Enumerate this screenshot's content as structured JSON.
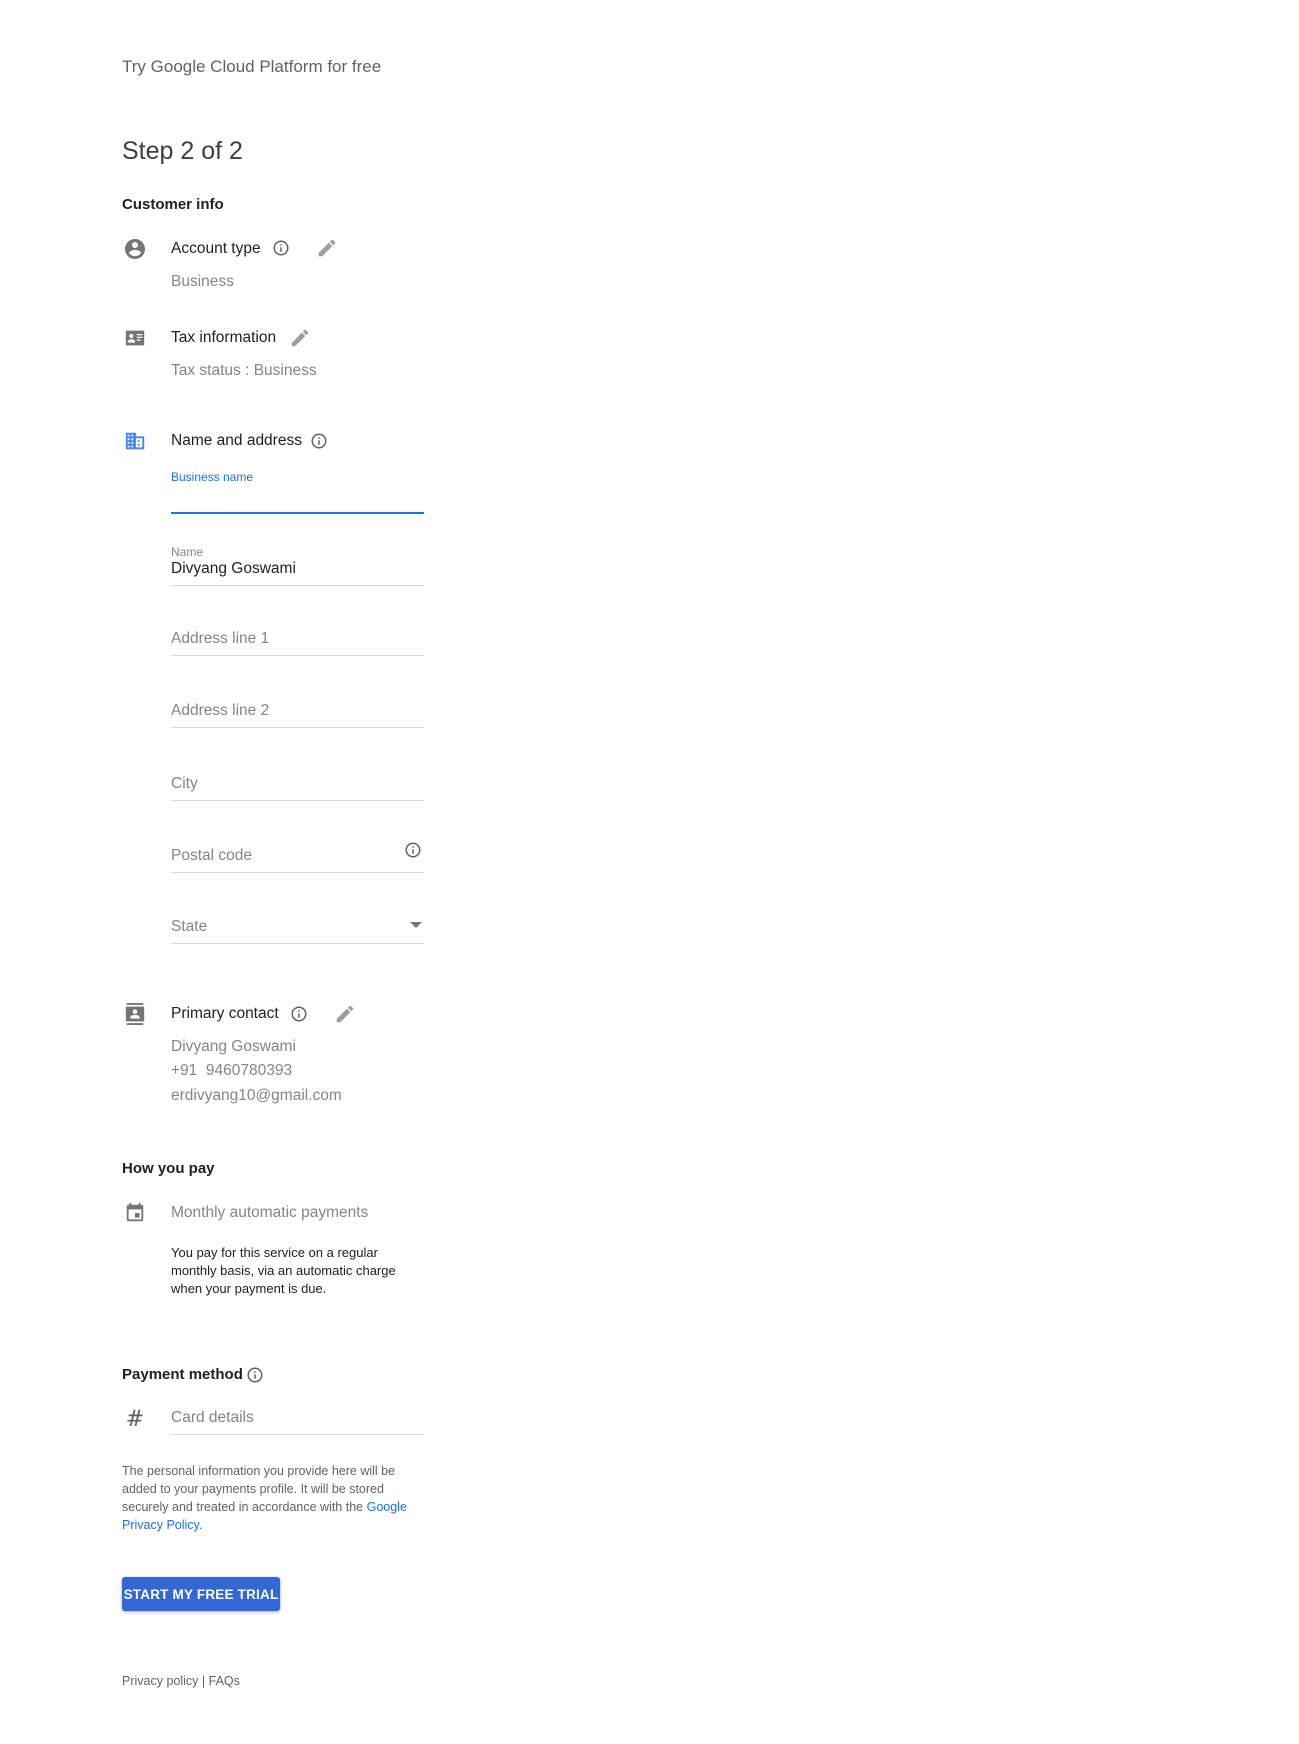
{
  "app_title": "Try Google Cloud Platform for free",
  "step": "Step 2 of 2",
  "customer_info": {
    "heading": "Customer info",
    "account_type": {
      "label": "Account type",
      "value": "Business"
    },
    "tax_information": {
      "label": "Tax information",
      "value": "Tax status : Business"
    },
    "name_and_address": {
      "label": "Name and address",
      "fields": {
        "business_name": {
          "label": "Business name",
          "value": ""
        },
        "name": {
          "label": "Name",
          "value": "Divyang Goswami"
        },
        "address_line_1": {
          "placeholder": "Address line 1"
        },
        "address_line_2": {
          "placeholder": "Address line 2"
        },
        "city": {
          "placeholder": "City"
        },
        "postal_code": {
          "placeholder": "Postal code"
        },
        "state": {
          "placeholder": "State"
        }
      }
    },
    "primary_contact": {
      "label": "Primary contact",
      "name": "Divyang Goswami",
      "phone": "+91  9460780393",
      "email": "erdivyang10@gmail.com"
    }
  },
  "how_you_pay": {
    "heading": "How you pay",
    "option": "Monthly automatic payments",
    "description": "You pay for this service on a regular monthly basis, via an automatic charge when your payment is due."
  },
  "payment_method": {
    "heading": "Payment method",
    "card_placeholder": "Card details",
    "notice_prefix": "The personal information you provide here will be added to your payments profile. It will be stored securely and treated in accordance with the ",
    "notice_link": "Google Privacy Policy",
    "notice_suffix": "."
  },
  "submit_button": "START MY FREE TRIAL",
  "footer": {
    "privacy": "Privacy policy",
    "separator": " | ",
    "faqs": "FAQs"
  },
  "colors": {
    "accent": "#1a73e8",
    "button": "#3367d6",
    "icon": "#757575"
  }
}
